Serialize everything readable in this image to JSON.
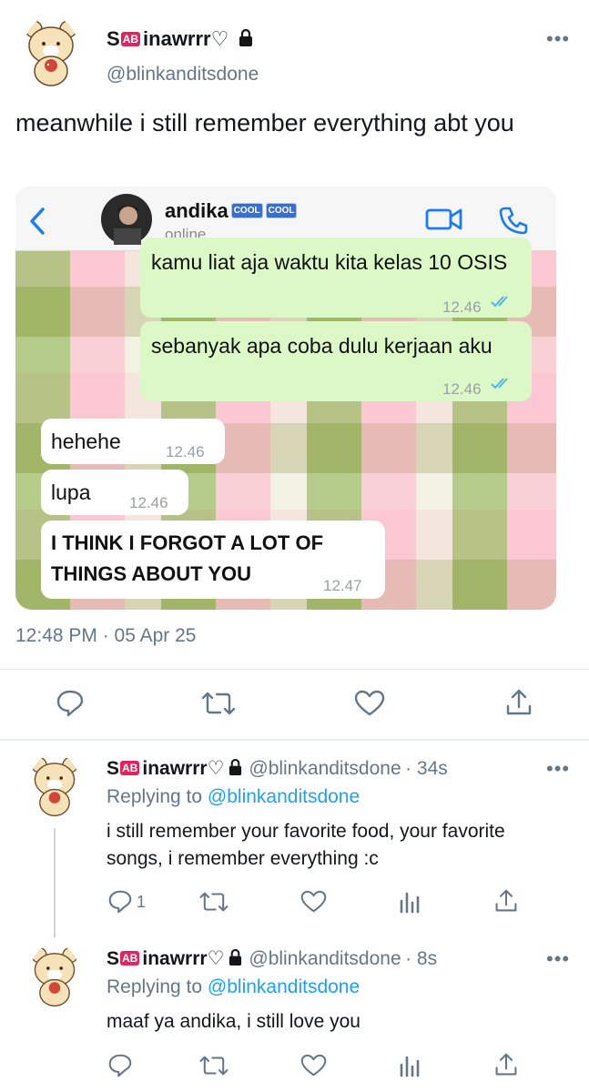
{
  "main_tweet": {
    "display_name": "inawrrr",
    "name_prefix": "S",
    "badge": "AB",
    "heart": "♡",
    "handle": "@blinkanditsdone",
    "more": "•••",
    "text": "meanwhile i still remember everything abt you",
    "timestamp": "12:48 PM · 05 Apr 25"
  },
  "chat": {
    "contact": "andika",
    "badge1": "COOL",
    "badge2": "COOL",
    "status": "online",
    "messages": [
      {
        "text": "kamu liat aja waktu kita kelas 10 OSIS",
        "time": "12.46",
        "dir": "out"
      },
      {
        "text": "sebanyak apa coba dulu kerjaan aku",
        "time": "12.46",
        "dir": "out"
      },
      {
        "text": "hehehe",
        "time": "12.46",
        "dir": "in"
      },
      {
        "text": "lupa",
        "time": "12.46",
        "dir": "in"
      },
      {
        "text": "I THINK I FORGOT A LOT OF THINGS ABOUT YOU",
        "time": "12.47",
        "dir": "in"
      }
    ]
  },
  "replies": [
    {
      "name_prefix": "S",
      "badge": "AB",
      "display_name": "inawrrr",
      "heart": "♡",
      "handle": "@blinkanditsdone",
      "time": "· 34s",
      "replying_prefix": "Replying to",
      "replying_to": "@blinkanditsdone",
      "text": "i still remember your favorite food, your favorite songs, i remember everything :c",
      "reply_count": "1"
    },
    {
      "name_prefix": "S",
      "badge": "AB",
      "display_name": "inawrrr",
      "heart": "♡",
      "handle": "@blinkanditsdone",
      "time": "· 8s",
      "replying_prefix": "Replying to",
      "replying_to": "@blinkanditsdone",
      "text": "maaf ya andika, i still love you",
      "reply_count": ""
    }
  ],
  "colors": {
    "link": "#1da1f2",
    "secondary": "#657786",
    "bubble_out": "#dcf8c6",
    "tick_blue": "#4fb6ec"
  }
}
